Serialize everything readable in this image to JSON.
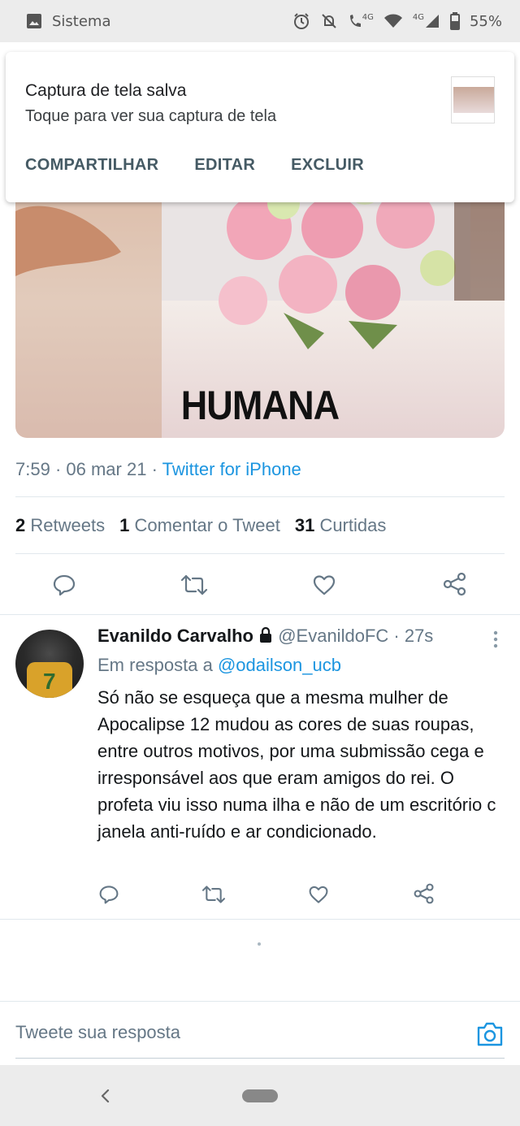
{
  "status_bar": {
    "app_label": "Sistema",
    "network_1": "4G",
    "network_2": "4G",
    "battery": "55%",
    "icons": [
      "image-icon",
      "alarm-icon",
      "mute-icon",
      "wifi-call-icon",
      "wifi-icon",
      "signal-icon",
      "battery-icon"
    ]
  },
  "notification": {
    "title": "Captura de tela salva",
    "subtitle": "Toque para ver sua captura de tela",
    "actions": [
      "COMPARTILHAR",
      "EDITAR",
      "EXCLUIR"
    ]
  },
  "tweet": {
    "image_text": "HUMANA",
    "time": "7:59",
    "date": "06 mar 21",
    "source": "Twitter for iPhone",
    "retweets_count": "2",
    "retweets_label": "Retweets",
    "comments_count": "1",
    "comments_label": "Comentar o Tweet",
    "likes_count": "31",
    "likes_label": "Curtidas"
  },
  "reply": {
    "name": "Evanildo Carvalho",
    "handle": "@EvanildoFC",
    "time": "27s",
    "replying_prefix": "Em resposta a",
    "replying_to": "@odailson_ucb",
    "avatar_text": "7",
    "body": "Só não se esqueça que a mesma mulher de Apocalipse 12 mudou as cores de suas roupas, entre outros motivos, por uma submissão cega e irresponsável aos que eram amigos do rei. O profeta viu isso numa ilha e não de um escritório c janela anti-ruído e ar condicionado."
  },
  "compose": {
    "placeholder": "Tweete sua resposta"
  },
  "colors": {
    "link": "#1b95e0",
    "muted": "#657786",
    "icon": "#657786"
  }
}
